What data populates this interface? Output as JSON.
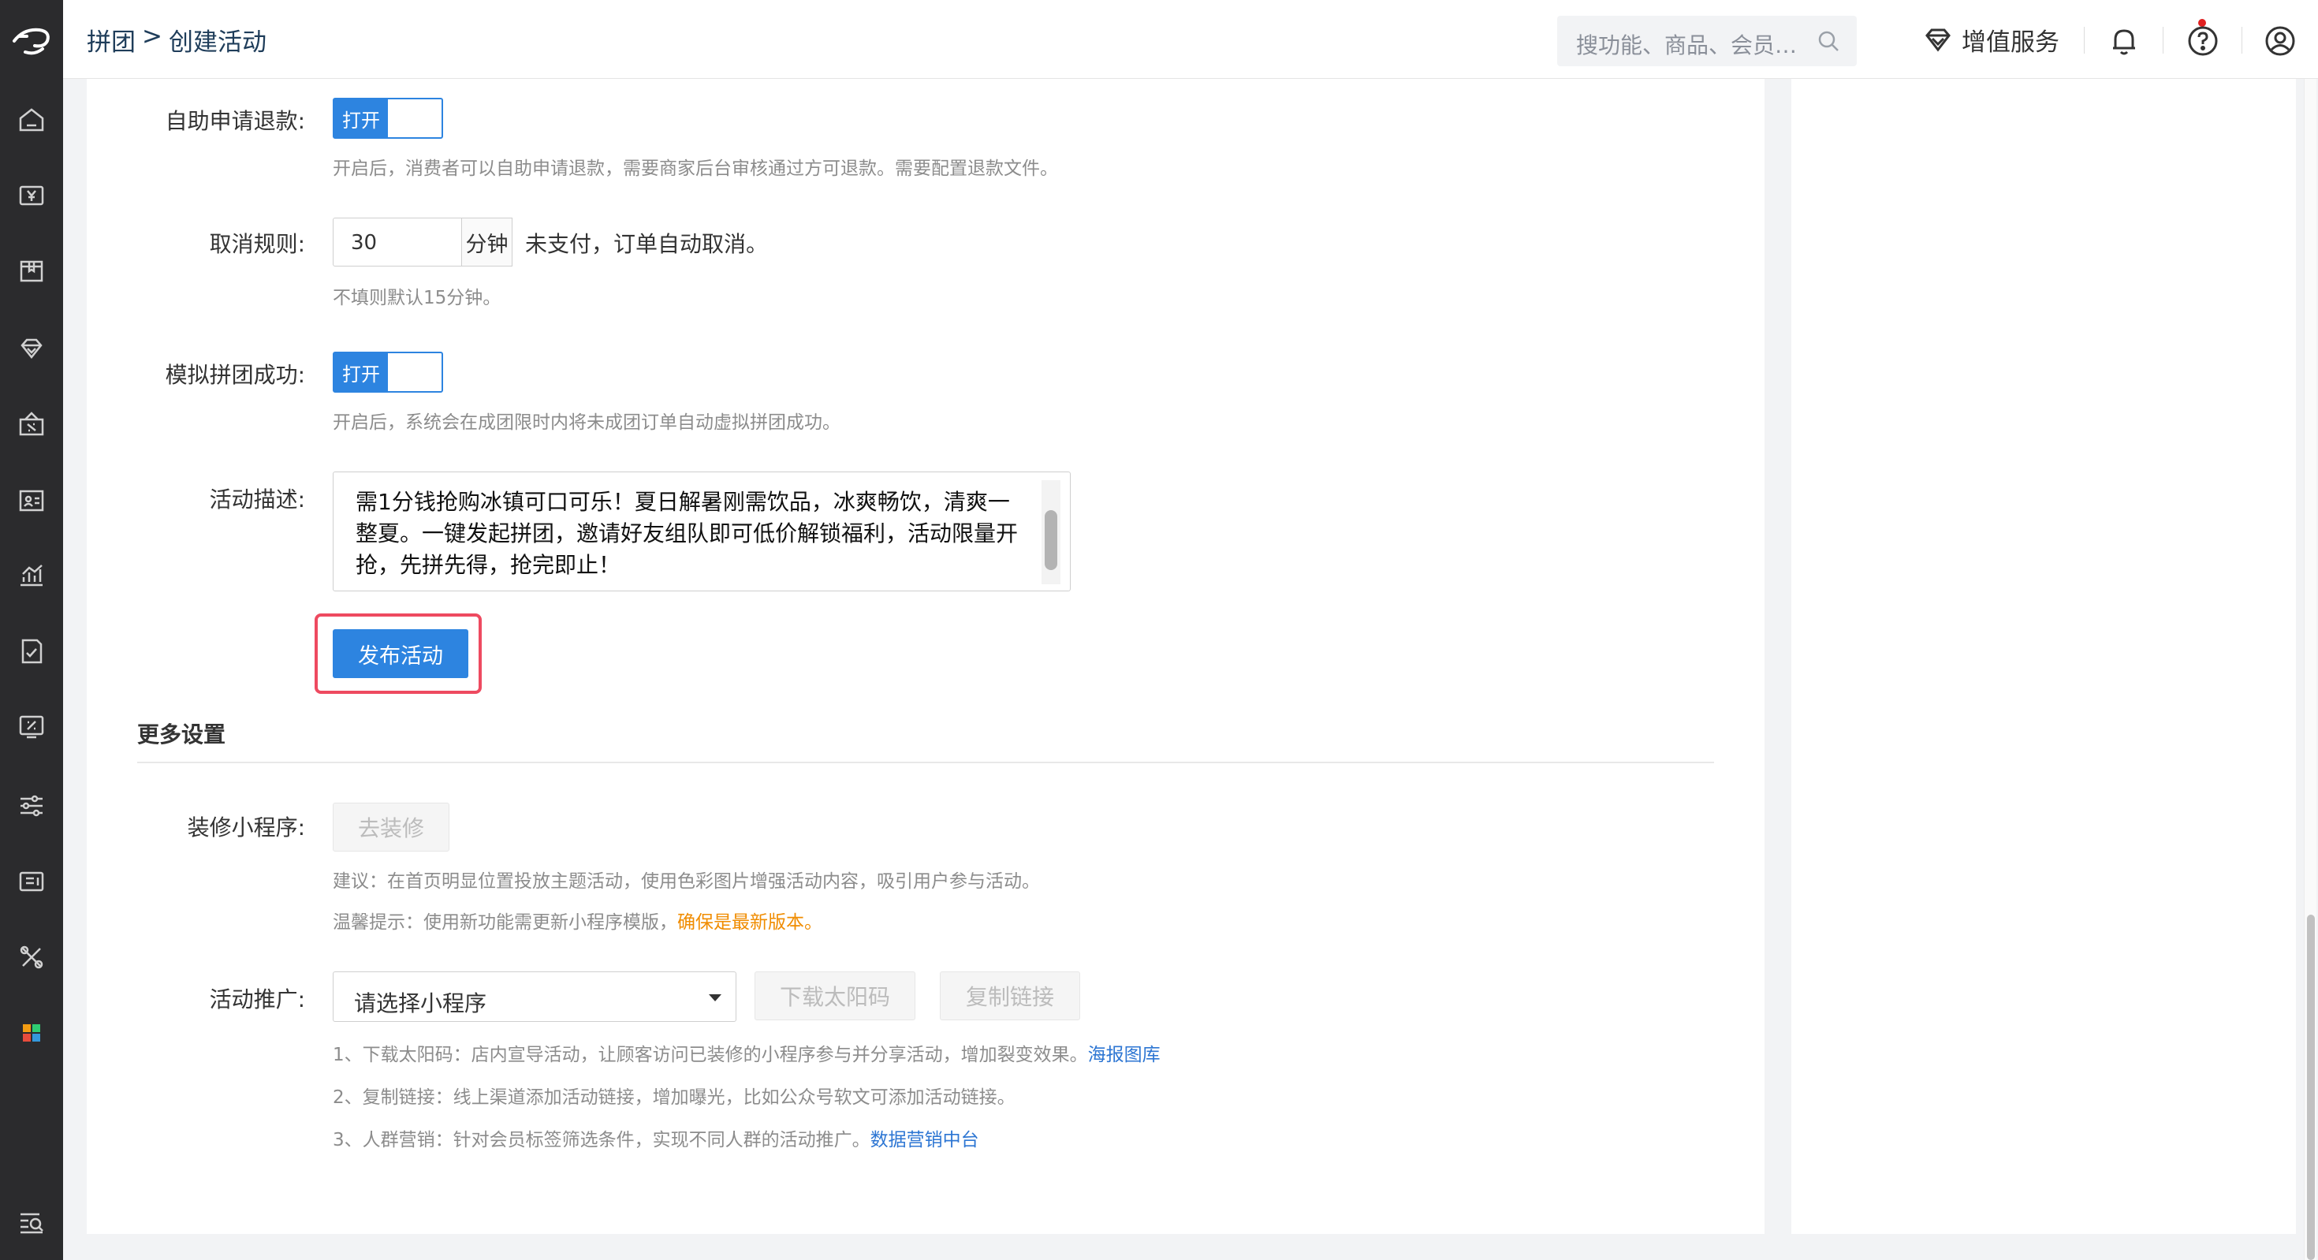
{
  "header": {
    "breadcrumb": [
      "拼团",
      ">",
      "创建活动"
    ],
    "search_placeholder": "搜功能、商品、会员…",
    "vip_label": "增值服务"
  },
  "form": {
    "refund": {
      "label": "自助申请退款:",
      "switch_label": "打开",
      "hint": "开启后，消费者可以自助申请退款，需要商家后台审核通过方可退款。需要配置退款文件。"
    },
    "cancel": {
      "label": "取消规则:",
      "value": "30",
      "unit": "分钟",
      "suffix": "未支付，订单自动取消。",
      "hint": "不填则默认15分钟。"
    },
    "simulate": {
      "label": "模拟拼团成功:",
      "switch_label": "打开",
      "hint": "开启后，系统会在成团限时内将未成团订单自动虚拟拼团成功。"
    },
    "description": {
      "label": "活动描述:",
      "lines": [
        "需1分钱抢购冰镇可口可乐！夏日解暑刚需饮品，冰爽畅饮，清爽一",
        "整夏。一键发起拼团，邀请好友组队即可低价解锁福利，活动限量开",
        "抢，先拼先得，抢完即止！"
      ]
    },
    "publish_button": "发布活动"
  },
  "more_settings": {
    "title": "更多设置",
    "decorate": {
      "label": "装修小程序:",
      "button": "去装修",
      "hint1": "建议：在首页明显位置投放主题活动，使用色彩图片增强活动内容，吸引用户参与活动。",
      "hint2_prefix": "温馨提示：使用新功能需更新小程序模版，",
      "hint2_highlight": "确保是最新版本。"
    },
    "promotion": {
      "label": "活动推广:",
      "select_value": "请选择小程序",
      "download_button": "下载太阳码",
      "copy_button": "复制链接",
      "note1_text": "1、下载太阳码：店内宣导活动，让顾客访问已装修的小程序参与并分享活动，增加裂变效果。",
      "note1_link": "海报图库",
      "note2_text": "2、复制链接：线上渠道添加活动链接，增加曝光，比如公众号软文可添加活动链接。",
      "note3_text": "3、人群营销：针对会员标签筛选条件，实现不同人群的活动推广。",
      "note3_link": "数据营销中台"
    }
  },
  "colors": {
    "primary": "#2d84e0",
    "highlight_border": "#ee4a60",
    "warning": "#f08c00",
    "sidebar_bg": "#2b2b2d"
  }
}
